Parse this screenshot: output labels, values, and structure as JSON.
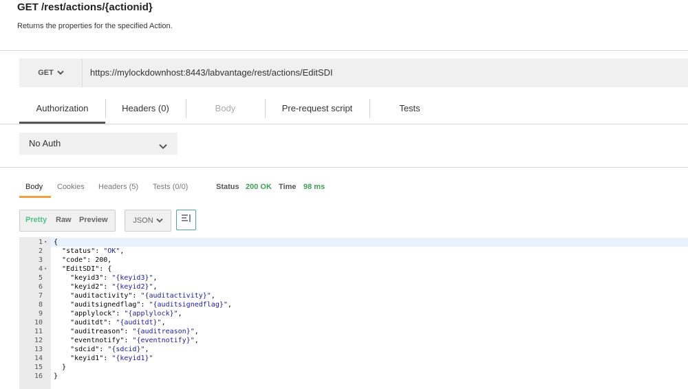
{
  "header": {
    "title": "GET /rest/actions/{actionid}",
    "description": "Returns the properties for the specified Action."
  },
  "request": {
    "method": "GET",
    "url": "https://mylockdownhost:8443/labvantage/rest/actions/EditSDI",
    "tabs": [
      {
        "label": "Authorization",
        "active": true
      },
      {
        "label": "Headers (0)",
        "active": false
      },
      {
        "label": "Body",
        "active": false,
        "disabled": true
      },
      {
        "label": "Pre-request script",
        "active": false
      },
      {
        "label": "Tests",
        "active": false
      }
    ],
    "auth_type": "No Auth"
  },
  "response": {
    "tabs": [
      {
        "label": "Body",
        "active": true
      },
      {
        "label": "Cookies"
      },
      {
        "label": "Headers (5)"
      },
      {
        "label": "Tests (0/0)"
      }
    ],
    "status_label": "Status",
    "status_value": "200 OK",
    "time_label": "Time",
    "time_value": "98 ms",
    "view_modes": [
      "Pretty",
      "Raw",
      "Preview"
    ],
    "active_view": "Pretty",
    "format": "JSON",
    "code_lines": [
      {
        "n": "1",
        "fold": true,
        "text": "{"
      },
      {
        "n": "2",
        "text": "  \"status\": \"OK\","
      },
      {
        "n": "3",
        "text": "  \"code\": 200,"
      },
      {
        "n": "4",
        "fold": true,
        "text": "  \"EditSDI\": {"
      },
      {
        "n": "5",
        "text": "    \"keyid3\": \"{keyid3}\","
      },
      {
        "n": "6",
        "text": "    \"keyid2\": \"{keyid2}\","
      },
      {
        "n": "7",
        "text": "    \"auditactivity\": \"{auditactivity}\","
      },
      {
        "n": "8",
        "text": "    \"auditsignedflag\": \"{auditsignedflag}\","
      },
      {
        "n": "9",
        "text": "    \"applylock\": \"{applylock}\","
      },
      {
        "n": "10",
        "text": "    \"auditdt\": \"{auditdt}\","
      },
      {
        "n": "11",
        "text": "    \"auditreason\": \"{auditreason}\","
      },
      {
        "n": "12",
        "text": "    \"eventnotify\": \"{eventnotify}\","
      },
      {
        "n": "13",
        "text": "    \"sdcid\": \"{sdcid}\","
      },
      {
        "n": "14",
        "text": "    \"keyid1\": \"{keyid1}\""
      },
      {
        "n": "15",
        "text": "  }"
      },
      {
        "n": "16",
        "text": "}"
      }
    ]
  },
  "colors": {
    "status_ok": "#3e9e55",
    "pretty_active": "#52c08b",
    "response_tab_accent": "#f0a040",
    "json_string": "#1a1aa6"
  },
  "icons": [
    "chevron-down-icon",
    "wrap-lines-icon",
    "fold-arrow-icon"
  ]
}
